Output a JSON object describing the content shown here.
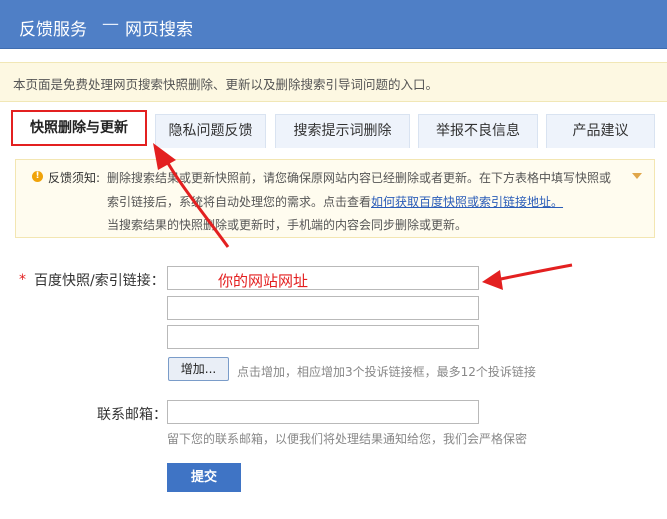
{
  "header": {
    "title": "反馈服务",
    "separator": "—",
    "subtitle": "网页搜索"
  },
  "notice": "本页面是免费处理网页搜索快照删除、更新以及删除搜索引导词问题的入口。",
  "tabs": [
    {
      "label": "快照删除与更新",
      "active": true
    },
    {
      "label": "隐私问题反馈",
      "active": false
    },
    {
      "label": "搜索提示词删除",
      "active": false
    },
    {
      "label": "举报不良信息",
      "active": false
    },
    {
      "label": "产品建议",
      "active": false
    }
  ],
  "tip": {
    "icon": "exclamation-icon",
    "label": "反馈须知:",
    "line1": "删除搜索结果或更新快照前，请您确保原网站内容已经删除或者更新。在下方表格中填写快照或",
    "line2_pre": "索引链接后，系统将自动处理您的需求。点击查看",
    "line2_link": "如何获取百度快照或索引链接地址。",
    "line3": "当搜索结果的快照删除或更新时，手机端的内容会同步删除或更新。"
  },
  "form": {
    "required_mark": "*",
    "link_label": "百度快照/索引链接：",
    "link_inputs": [
      "",
      "",
      ""
    ],
    "annotation": "你的网站网址",
    "add_button": "增加...",
    "add_hint": "点击增加，相应增加3个投诉链接框，最多12个投诉链接",
    "email_label": "联系邮箱：",
    "email_value": "",
    "email_hint": "留下您的联系邮箱，以便我们将处理结果通知给您，我们会严格保密",
    "submit": "提交"
  },
  "colors": {
    "header_bg": "#4f7fc6",
    "accent_red": "#e32020",
    "submit_bg": "#3f74c5",
    "link": "#2a5cb8"
  }
}
